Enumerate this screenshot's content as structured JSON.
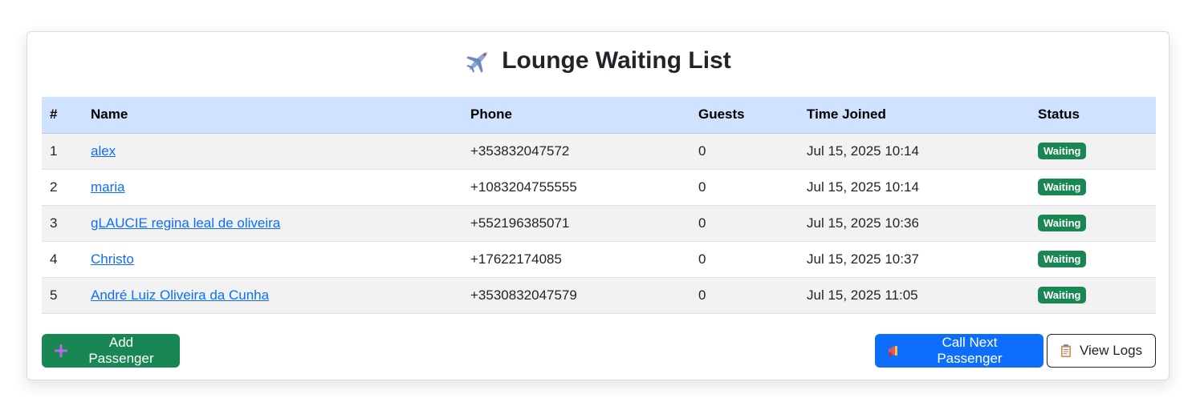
{
  "header": {
    "title": "Lounge Waiting List",
    "icon": "airplane-icon"
  },
  "table": {
    "columns": [
      "#",
      "Name",
      "Phone",
      "Guests",
      "Time Joined",
      "Status"
    ],
    "rows": [
      {
        "num": "1",
        "name": "alex",
        "phone": "+353832047572",
        "guests": "0",
        "time": "Jul 15, 2025 10:14",
        "status": "Waiting"
      },
      {
        "num": "2",
        "name": "maria",
        "phone": "+1083204755555",
        "guests": "0",
        "time": "Jul 15, 2025 10:14",
        "status": "Waiting"
      },
      {
        "num": "3",
        "name": "gLAUCIE regina leal de oliveira",
        "phone": "+552196385071",
        "guests": "0",
        "time": "Jul 15, 2025 10:36",
        "status": "Waiting"
      },
      {
        "num": "4",
        "name": "Christo",
        "phone": "+17622174085",
        "guests": "0",
        "time": "Jul 15, 2025 10:37",
        "status": "Waiting"
      },
      {
        "num": "5",
        "name": "André Luiz Oliveira da Cunha",
        "phone": "+3530832047579",
        "guests": "0",
        "time": "Jul 15, 2025 11:05",
        "status": "Waiting"
      }
    ]
  },
  "actions": {
    "add_label": "Add Passenger",
    "call_label": "Call Next Passenger",
    "logs_label": "View Logs"
  },
  "colors": {
    "header_bg": "#cfe2ff",
    "success": "#198754",
    "primary": "#0d6efd",
    "link": "#0d6efd"
  }
}
